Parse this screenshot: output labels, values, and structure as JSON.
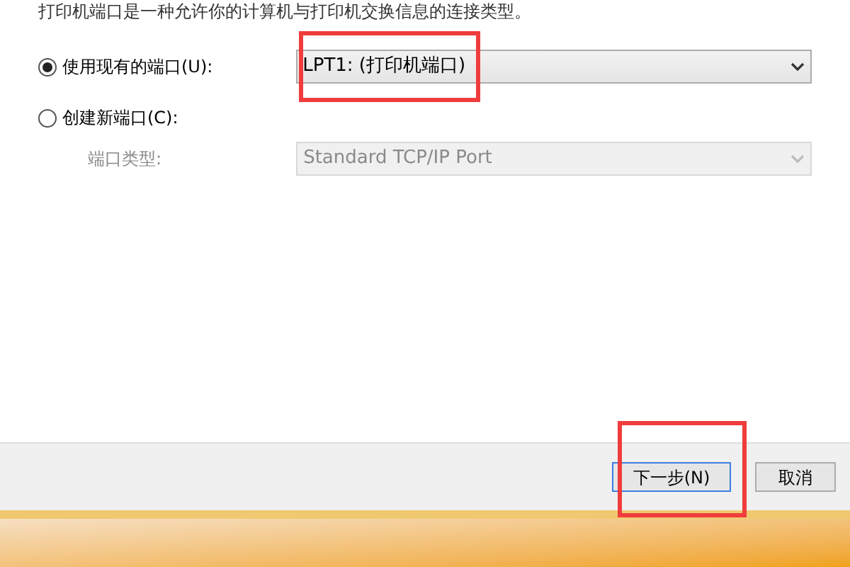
{
  "intro": "打印机端口是一种允许你的计算机与打印机交换信息的连接类型。",
  "options": [
    {
      "label": "使用现有的端口(U):",
      "selected": true,
      "dropdown": {
        "value": "LPT1: (打印机端口)",
        "disabled": false
      }
    },
    {
      "label": "创建新端口(C):",
      "selected": false,
      "sublabel": "端口类型:",
      "dropdown": {
        "value": "Standard TCP/IP Port",
        "disabled": true
      }
    }
  ],
  "buttons": [
    {
      "label": "下一步(N)",
      "selected": true
    },
    {
      "label": "取消",
      "selected": false
    }
  ]
}
